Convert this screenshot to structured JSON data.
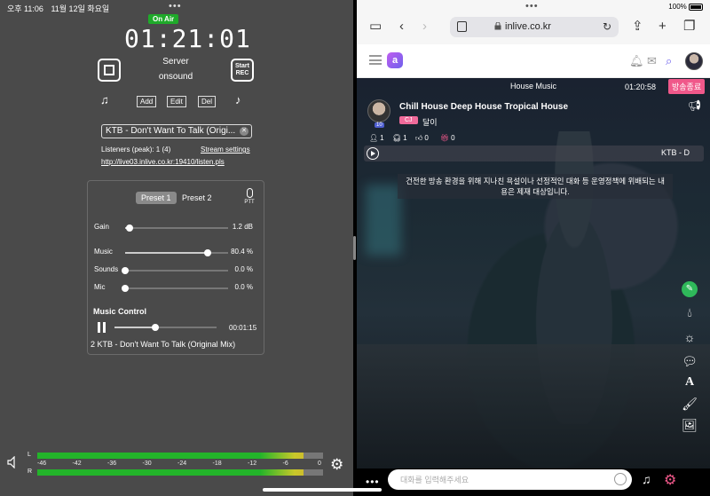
{
  "status": {
    "time": "오후 11:06",
    "date": "11월 12일 화요일",
    "battery": "100%"
  },
  "left": {
    "on_air": "On Air",
    "timer": "01:21:01",
    "server_label": "Server",
    "server_value": "onsound",
    "rec_label_1": "Start",
    "rec_label_2": "REC",
    "buttons": {
      "add": "Add",
      "edit": "Edit",
      "del": "Del"
    },
    "current_track": "KTB - Don't Want To Talk (Origi...",
    "listeners": "Listeners (peak):   1 (4)",
    "stream_settings": "Stream settings",
    "listen_url": "http://live03.inlive.co.kr:19410/listen.pls",
    "presets": {
      "p1": "Preset 1",
      "p2": "Preset 2",
      "ptt": "PTT"
    },
    "mixer": [
      {
        "label": "Gain",
        "value": "1.2 dB",
        "level": 0.04
      },
      {
        "label": "Music",
        "value": "80.4 %",
        "level": 0.804
      },
      {
        "label": "Sounds",
        "value": "0.0 %",
        "level": 0.0
      },
      {
        "label": "Mic",
        "value": "0.0 %",
        "level": 0.0
      }
    ],
    "music_control": {
      "title": "Music Control",
      "time": "00:01:15",
      "progress": 0.4,
      "track": "2 KTB - Don't Want To Talk (Original Mix)"
    },
    "meter": {
      "left_label": "L",
      "right_label": "R",
      "scale": [
        "-46",
        "-42",
        "-36",
        "-30",
        "-24",
        "-18",
        "-12",
        "-6",
        "0"
      ]
    }
  },
  "right": {
    "url": "inlive.co.kr",
    "logo_letter": "a",
    "genre": "House Music",
    "stage_time": "01:20:58",
    "end_broadcast": "방송종료",
    "dj_level": "10",
    "room_title": "Chill House Deep House Tropical House",
    "cj_badge": "CJ",
    "dj_name": "달이",
    "stats": {
      "listeners": "1",
      "headphones": "1",
      "likes": "0",
      "gifts": "0"
    },
    "now_playing": "KTB - D",
    "notice": "건전한 방송 환경을 위해 지나친 욕설이나 선정적인 대화 등 운영정책에 위배되는 내용은 제재 대상입니다.",
    "chat_placeholder": "대화를 입력해주세요"
  },
  "colors": {
    "on_air": "#1faa2a",
    "accent_pink": "#f0588a",
    "meter_green": "#23b42a"
  }
}
